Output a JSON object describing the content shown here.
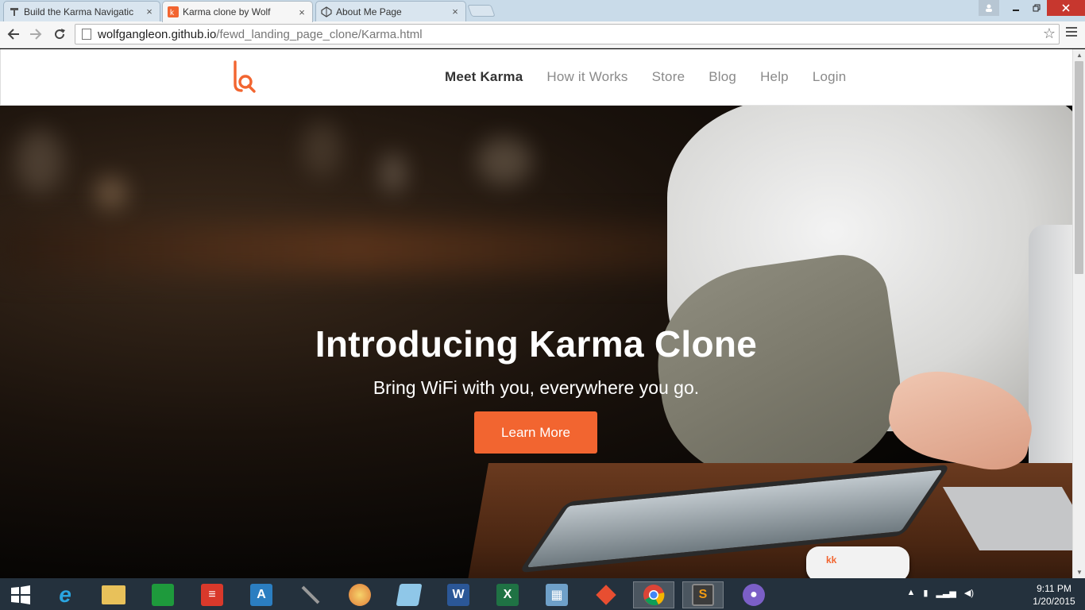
{
  "browser": {
    "tabs": [
      {
        "title": "Build the Karma Navigatic",
        "active": false,
        "icon": "document-icon"
      },
      {
        "title": "Karma clone by Wolf",
        "active": true,
        "icon": "karma-favicon"
      },
      {
        "title": "About Me Page",
        "active": false,
        "icon": "codepen-icon"
      }
    ],
    "close_glyph": "×",
    "url_host": "wolfgangleon.github.io",
    "url_path": "/fewd_landing_page_clone/Karma.html"
  },
  "site": {
    "brand_color": "#f26530",
    "nav": [
      {
        "label": "Meet Karma",
        "active": true
      },
      {
        "label": "How it Works",
        "active": false
      },
      {
        "label": "Store",
        "active": false
      },
      {
        "label": "Blog",
        "active": false
      },
      {
        "label": "Help",
        "active": false
      },
      {
        "label": "Login",
        "active": false
      }
    ],
    "hero": {
      "title": "Introducing Karma Clone",
      "subtitle": "Bring WiFi with you, everywhere you go.",
      "cta_label": "Learn More"
    }
  },
  "taskbar": {
    "apps": [
      "windows-start-icon",
      "internet-explorer-icon",
      "file-explorer-icon",
      "store-icon",
      "todoist-icon",
      "app-icon",
      "pen-tool-icon",
      "paint-icon",
      "notepad-icon",
      "word-icon",
      "excel-icon",
      "calculator-icon",
      "git-icon",
      "chrome-icon",
      "sublime-text-icon",
      "github-icon"
    ],
    "time": "9:11 PM",
    "date": "1/20/2015"
  }
}
